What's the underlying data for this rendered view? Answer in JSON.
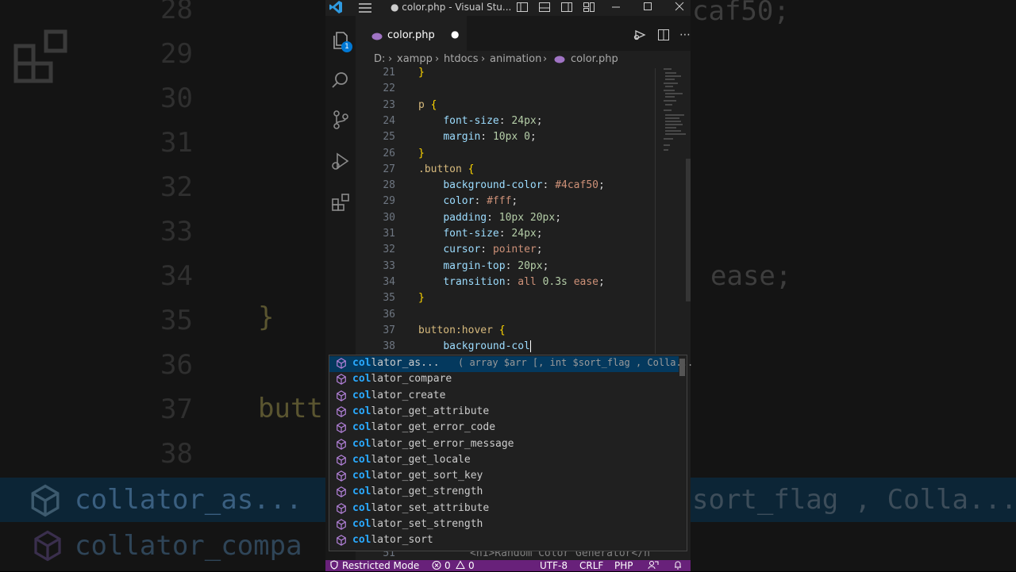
{
  "titlebar": {
    "title": "● color.php - Visual Stu..."
  },
  "tab": {
    "filename": "color.php",
    "unsaved_dot": "●"
  },
  "badge_count": "1",
  "breadcrumb": [
    "D:",
    "xampp",
    "htdocs",
    "animation",
    "color.php"
  ],
  "code_lines": [
    {
      "n": "21",
      "segs": [
        [
          "brace",
          "}"
        ]
      ]
    },
    {
      "n": "22",
      "segs": []
    },
    {
      "n": "23",
      "segs": [
        [
          "k",
          "p "
        ],
        [
          "brace",
          "{"
        ]
      ]
    },
    {
      "n": "24",
      "segs": [
        [
          "punct",
          "    "
        ],
        [
          "prop",
          "font-size"
        ],
        [
          "punct",
          ": "
        ],
        [
          "num",
          "24px"
        ],
        [
          "punct",
          ";"
        ]
      ]
    },
    {
      "n": "25",
      "segs": [
        [
          "punct",
          "    "
        ],
        [
          "prop",
          "margin"
        ],
        [
          "punct",
          ": "
        ],
        [
          "num",
          "10px 0"
        ],
        [
          "punct",
          ";"
        ]
      ]
    },
    {
      "n": "26",
      "segs": [
        [
          "brace",
          "}"
        ]
      ]
    },
    {
      "n": "27",
      "segs": [
        [
          "k",
          ".button "
        ],
        [
          "brace",
          "{"
        ]
      ]
    },
    {
      "n": "28",
      "segs": [
        [
          "punct",
          "    "
        ],
        [
          "prop",
          "background-color"
        ],
        [
          "punct",
          ": "
        ],
        [
          "val",
          "#4caf50"
        ],
        [
          "punct",
          ";"
        ]
      ]
    },
    {
      "n": "29",
      "segs": [
        [
          "punct",
          "    "
        ],
        [
          "prop",
          "color"
        ],
        [
          "punct",
          ": "
        ],
        [
          "val",
          "#fff"
        ],
        [
          "punct",
          ";"
        ]
      ]
    },
    {
      "n": "30",
      "segs": [
        [
          "punct",
          "    "
        ],
        [
          "prop",
          "padding"
        ],
        [
          "punct",
          ": "
        ],
        [
          "num",
          "10px 20px"
        ],
        [
          "punct",
          ";"
        ]
      ]
    },
    {
      "n": "31",
      "segs": [
        [
          "punct",
          "    "
        ],
        [
          "prop",
          "font-size"
        ],
        [
          "punct",
          ": "
        ],
        [
          "num",
          "24px"
        ],
        [
          "punct",
          ";"
        ]
      ]
    },
    {
      "n": "32",
      "segs": [
        [
          "punct",
          "    "
        ],
        [
          "prop",
          "cursor"
        ],
        [
          "punct",
          ": "
        ],
        [
          "val",
          "pointer"
        ],
        [
          "punct",
          ";"
        ]
      ]
    },
    {
      "n": "33",
      "segs": [
        [
          "punct",
          "    "
        ],
        [
          "prop",
          "margin-top"
        ],
        [
          "punct",
          ": "
        ],
        [
          "num",
          "20px"
        ],
        [
          "punct",
          ";"
        ]
      ]
    },
    {
      "n": "34",
      "segs": [
        [
          "punct",
          "    "
        ],
        [
          "prop",
          "transition"
        ],
        [
          "punct",
          ": "
        ],
        [
          "val",
          "all "
        ],
        [
          "num",
          "0.3s"
        ],
        [
          "val",
          " ease"
        ],
        [
          "punct",
          ";"
        ]
      ]
    },
    {
      "n": "35",
      "segs": [
        [
          "brace",
          "}"
        ]
      ]
    },
    {
      "n": "36",
      "segs": []
    },
    {
      "n": "37",
      "segs": [
        [
          "k",
          "button:hover "
        ],
        [
          "brace",
          "{"
        ]
      ]
    },
    {
      "n": "38",
      "segs": [
        [
          "punct",
          "    "
        ],
        [
          "prop",
          "background-col"
        ]
      ]
    }
  ],
  "bottom_line": {
    "n": "51",
    "text": "<h1>Random Color Generator</h"
  },
  "suggestions": [
    {
      "match": "col",
      "rest": "lator_as...",
      "detail": "( array $arr [, int $sort_flag , Colla...",
      "selected": true
    },
    {
      "match": "col",
      "rest": "lator_compare"
    },
    {
      "match": "col",
      "rest": "lator_create"
    },
    {
      "match": "col",
      "rest": "lator_get_attribute"
    },
    {
      "match": "col",
      "rest": "lator_get_error_code"
    },
    {
      "match": "col",
      "rest": "lator_get_error_message"
    },
    {
      "match": "col",
      "rest": "lator_get_locale"
    },
    {
      "match": "col",
      "rest": "lator_get_sort_key"
    },
    {
      "match": "col",
      "rest": "lator_get_strength"
    },
    {
      "match": "col",
      "rest": "lator_set_attribute"
    },
    {
      "match": "col",
      "rest": "lator_set_strength"
    },
    {
      "match": "col",
      "rest": "lator_sort"
    }
  ],
  "status": {
    "restricted": "Restricted Mode",
    "errors": "0",
    "warnings": "0",
    "encoding": "UTF-8",
    "eol": "CRLF",
    "language": "PHP"
  },
  "background": {
    "numbers": [
      "28",
      "29",
      "30",
      "31",
      "32",
      "33",
      "34",
      "35",
      "36",
      "37",
      "38"
    ],
    "left_brace": "}",
    "left_butt": "butt",
    "right_top": "caf50;",
    "right_ease": "ease;",
    "suggest_sel_left": "collator_as...",
    "suggest_sel_right": "sort_flag , Colla...",
    "suggest_second_left": "collator_compa"
  },
  "colors": {
    "status_bg": "#68217a",
    "accent": "#0078d4",
    "selection": "#04395e"
  }
}
